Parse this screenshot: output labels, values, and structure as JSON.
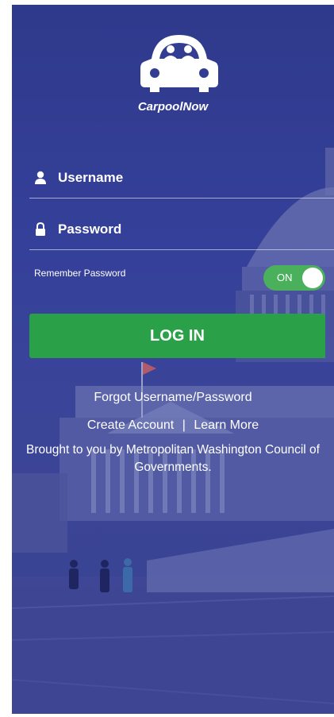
{
  "app": {
    "name": "CarpoolNow"
  },
  "login_form": {
    "username_placeholder": "Username",
    "password_placeholder": "Password",
    "remember_label": "Remember Password",
    "remember_toggle_label": "ON",
    "remember_toggle_on": true,
    "login_button_label": "LOG IN"
  },
  "links": {
    "forgot": "Forgot Username/Password",
    "create_account": "Create Account",
    "separator": "|",
    "learn_more": "Learn More"
  },
  "footer": {
    "credit_line1": "Brought to you by Metropolitan Washington Council of",
    "credit_line2": "Governments."
  },
  "colors": {
    "background_tint": "#333d91",
    "accent_green": "#2aa149",
    "toggle_green": "#4bb05c",
    "text": "#ffffff"
  },
  "icons": {
    "logo": "car-with-people-icon",
    "username": "user-icon",
    "password": "lock-icon"
  }
}
